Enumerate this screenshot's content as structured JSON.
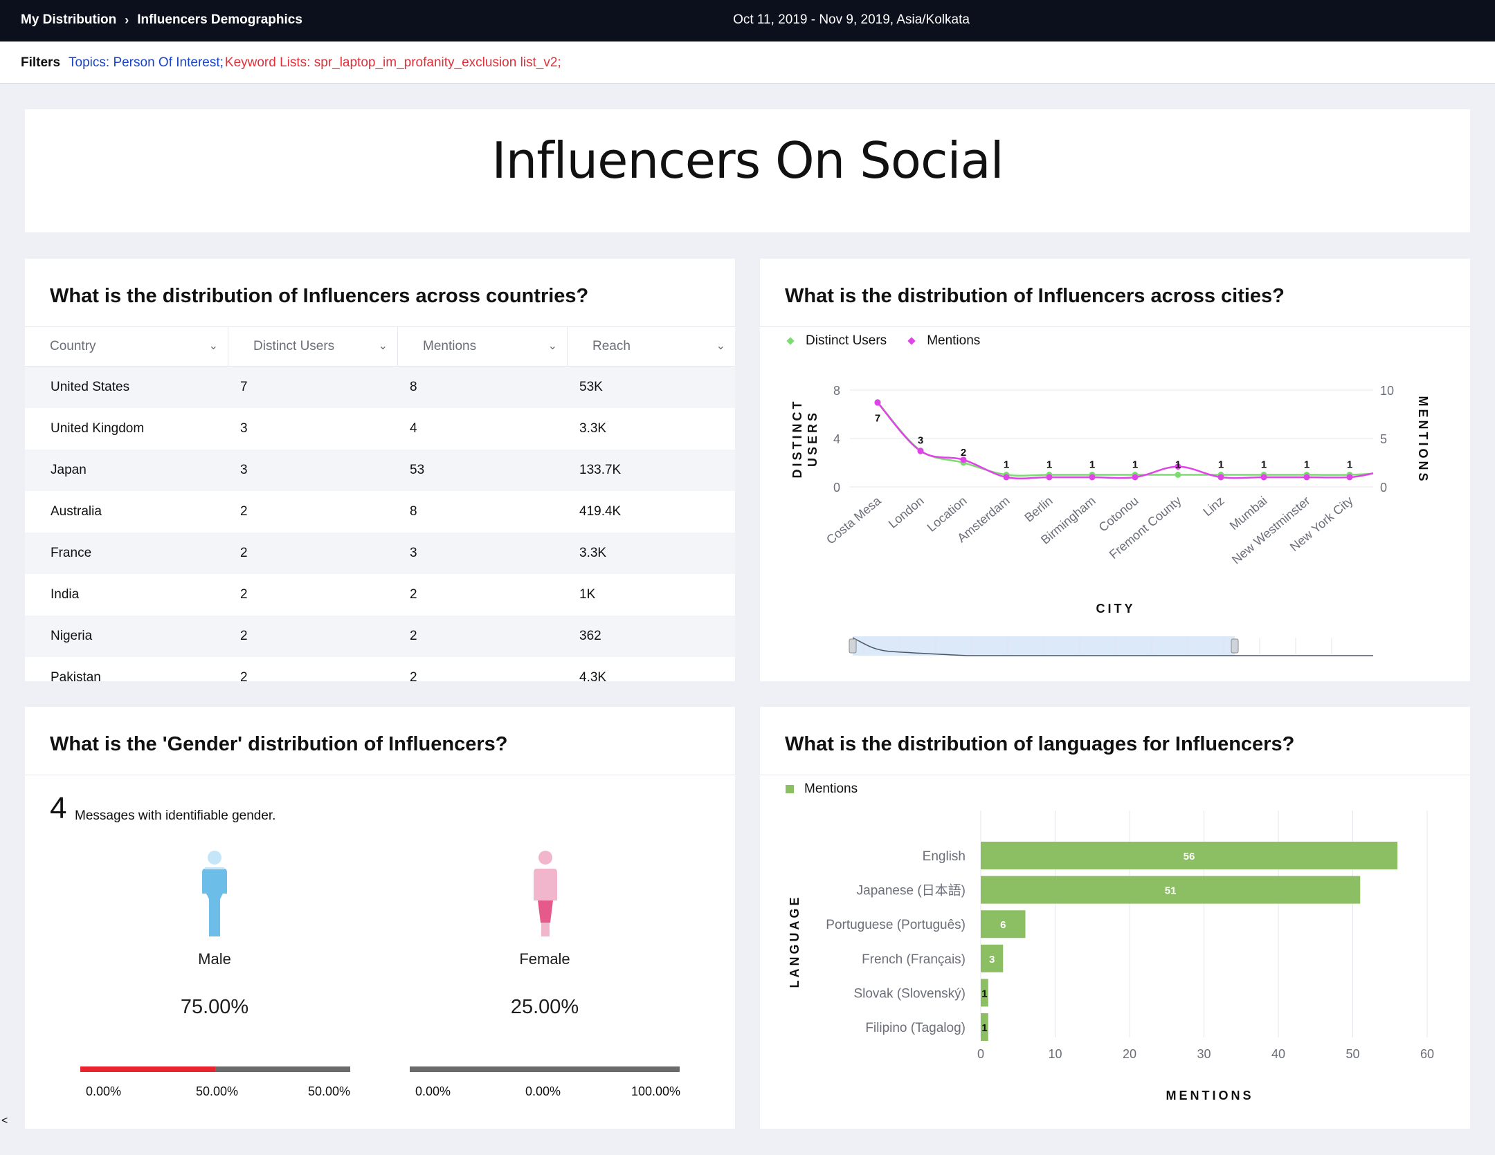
{
  "header": {
    "breadcrumb_root": "My Distribution",
    "breadcrumb_current": "Influencers Demographics",
    "date_range": "Oct 11, 2019 - Nov 9, 2019, Asia/Kolkata"
  },
  "filters": {
    "label": "Filters",
    "topics": "Topics: Person Of Interest;",
    "keyword_lists": "Keyword Lists: spr_laptop_im_profanity_exclusion list_v2;"
  },
  "page_title": "Influencers On Social",
  "countries": {
    "title": "What is the distribution of Influencers across countries?",
    "columns": [
      "Country",
      "Distinct Users",
      "Mentions",
      "Reach"
    ],
    "rows": [
      [
        "United States",
        "7",
        "8",
        "53K"
      ],
      [
        "United Kingdom",
        "3",
        "4",
        "3.3K"
      ],
      [
        "Japan",
        "3",
        "53",
        "133.7K"
      ],
      [
        "Australia",
        "2",
        "8",
        "419.4K"
      ],
      [
        "France",
        "2",
        "3",
        "3.3K"
      ],
      [
        "India",
        "2",
        "2",
        "1K"
      ],
      [
        "Nigeria",
        "2",
        "2",
        "362"
      ],
      [
        "Pakistan",
        "2",
        "2",
        "4.3K"
      ]
    ]
  },
  "cities": {
    "title": "What is the distribution of Influencers across cities?",
    "legend": [
      "Distinct Users",
      "Mentions"
    ]
  },
  "gender": {
    "title": "What is the 'Gender' distribution of Influencers?",
    "count": "4",
    "count_label": "Messages with identifiable gender.",
    "male": {
      "label": "Male",
      "pct": "75.00%",
      "bar_fill": 0.5,
      "ticks": [
        "0.00%",
        "50.00%",
        "50.00%"
      ]
    },
    "female": {
      "label": "Female",
      "pct": "25.00%",
      "bar_fill": 0.0,
      "ticks": [
        "0.00%",
        "0.00%",
        "100.00%"
      ]
    }
  },
  "languages": {
    "title": "What is the distribution of languages for Influencers?",
    "legend": "Mentions"
  },
  "colors": {
    "distinct_users": "#7cdc72",
    "mentions_line": "#e043e8",
    "language_bar": "#8cbf63",
    "male_icon": "#6dbde9",
    "female_icon": "#f2b6cc",
    "bar_red": "#e8242e"
  },
  "chart_data": [
    {
      "type": "line",
      "categories": [
        "Costa Mesa",
        "London",
        "Location",
        "Amsterdam",
        "Berlin",
        "Birmingham",
        "Cotonou",
        "Fremont County",
        "Linz",
        "Mumbai",
        "New Westminster",
        "New York City"
      ],
      "series": [
        {
          "name": "Distinct Users",
          "axis": "left",
          "values": [
            7,
            3,
            2,
            1,
            1,
            1,
            1,
            1,
            1,
            1,
            1,
            1
          ]
        },
        {
          "name": "Mentions",
          "axis": "right",
          "values": [
            8.7,
            3.7,
            2.8,
            1,
            1,
            1,
            1,
            2.1,
            1,
            1,
            1,
            1
          ]
        }
      ],
      "data_labels": [
        "7",
        "3",
        "2",
        "1",
        "1",
        "1",
        "1",
        "1",
        "1",
        "1",
        "1",
        "1"
      ],
      "xlabel": "CITY",
      "ylabel": "DISTINCT USERS",
      "y2label": "MENTIONS",
      "ylim": [
        0,
        8
      ],
      "y2lim": [
        0,
        10
      ],
      "yticks": [
        "0",
        "4",
        "8"
      ],
      "y2ticks": [
        "0",
        "5",
        "10"
      ],
      "grid": true,
      "legend": "top-left"
    },
    {
      "type": "bar",
      "orientation": "horizontal",
      "categories": [
        "English",
        "Japanese (日本語)",
        "Portuguese (Português)",
        "French (Français)",
        "Slovak (Slovenský)",
        "Filipino (Tagalog)"
      ],
      "series": [
        {
          "name": "Mentions",
          "values": [
            56,
            51,
            6,
            3,
            1,
            1
          ]
        }
      ],
      "xlabel": "MENTIONS",
      "ylabel": "LANGUAGE",
      "xlim": [
        0,
        60
      ],
      "xticks": [
        "0",
        "10",
        "20",
        "30",
        "40",
        "50",
        "60"
      ],
      "grid": true,
      "legend": "top-left"
    }
  ]
}
